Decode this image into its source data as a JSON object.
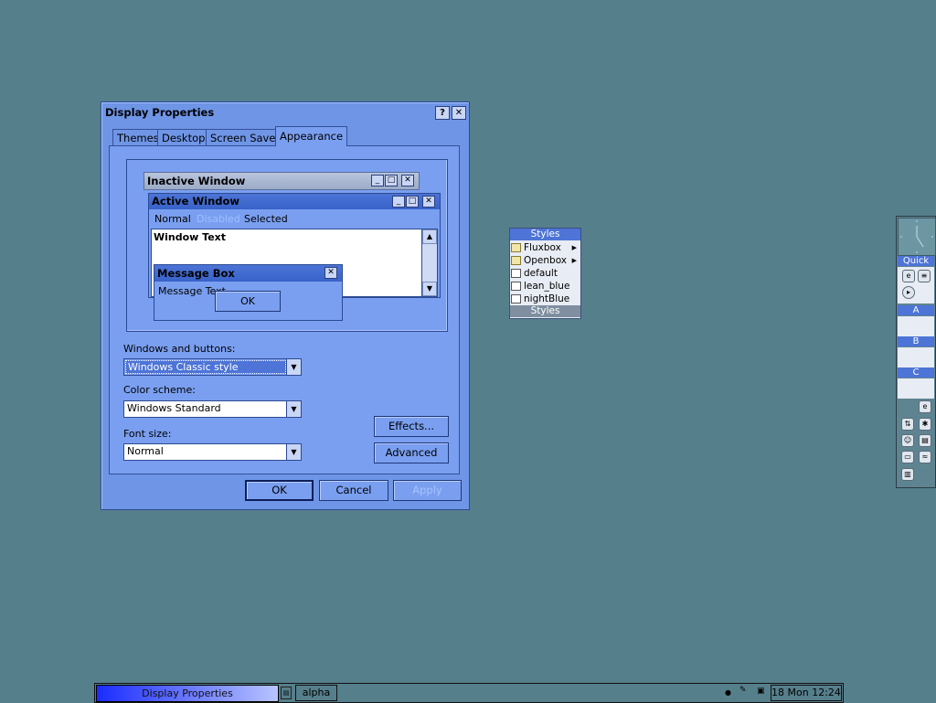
{
  "dialog": {
    "title": "Display Properties",
    "help_glyph": "?",
    "close_glyph": "✕",
    "tabs": [
      {
        "label": "Themes"
      },
      {
        "label": "Desktop"
      },
      {
        "label": "Screen Saver"
      },
      {
        "label": "Appearance",
        "active": true
      }
    ],
    "preview": {
      "inactive_title": "Inactive Window",
      "active_title": "Active Window",
      "menu": {
        "normal": "Normal",
        "disabled": "Disabled",
        "selected": "Selected"
      },
      "window_text": "Window Text",
      "message_box_title": "Message Box",
      "message_text": "Message Text",
      "ok_label": "OK"
    },
    "windows_buttons_label": "Windows and buttons:",
    "windows_buttons_value": "Windows Classic style",
    "color_scheme_label": "Color scheme:",
    "color_scheme_value": "Windows Standard",
    "font_size_label": "Font size:",
    "font_size_value": "Normal",
    "effects_label": "Effects...",
    "advanced_label": "Advanced",
    "ok_label": "OK",
    "cancel_label": "Cancel",
    "apply_label": "Apply"
  },
  "styles_menu": {
    "title": "Styles",
    "items": [
      {
        "label": "Fluxbox",
        "submenu": true,
        "icon": "folder-icon"
      },
      {
        "label": "Openbox",
        "submenu": true,
        "icon": "folder-icon"
      },
      {
        "label": "default",
        "icon": "style-file-icon"
      },
      {
        "label": "lean_blue",
        "icon": "style-file-icon"
      },
      {
        "label": "nightBlue",
        "icon": "style-file-icon"
      }
    ],
    "footer": "Styles"
  },
  "slit": {
    "quick_label": "Quick",
    "a_label": "A",
    "b_label": "B",
    "c_label": "C"
  },
  "taskbar": {
    "task_label": "Display Properties",
    "workspace": "alpha",
    "clock": "18 Mon 12:24"
  },
  "colors": {
    "desktop": "#567f8c",
    "dialog": "#6f95e6",
    "active_caption": "#3863c9",
    "menu_title": "#4d74d6"
  }
}
